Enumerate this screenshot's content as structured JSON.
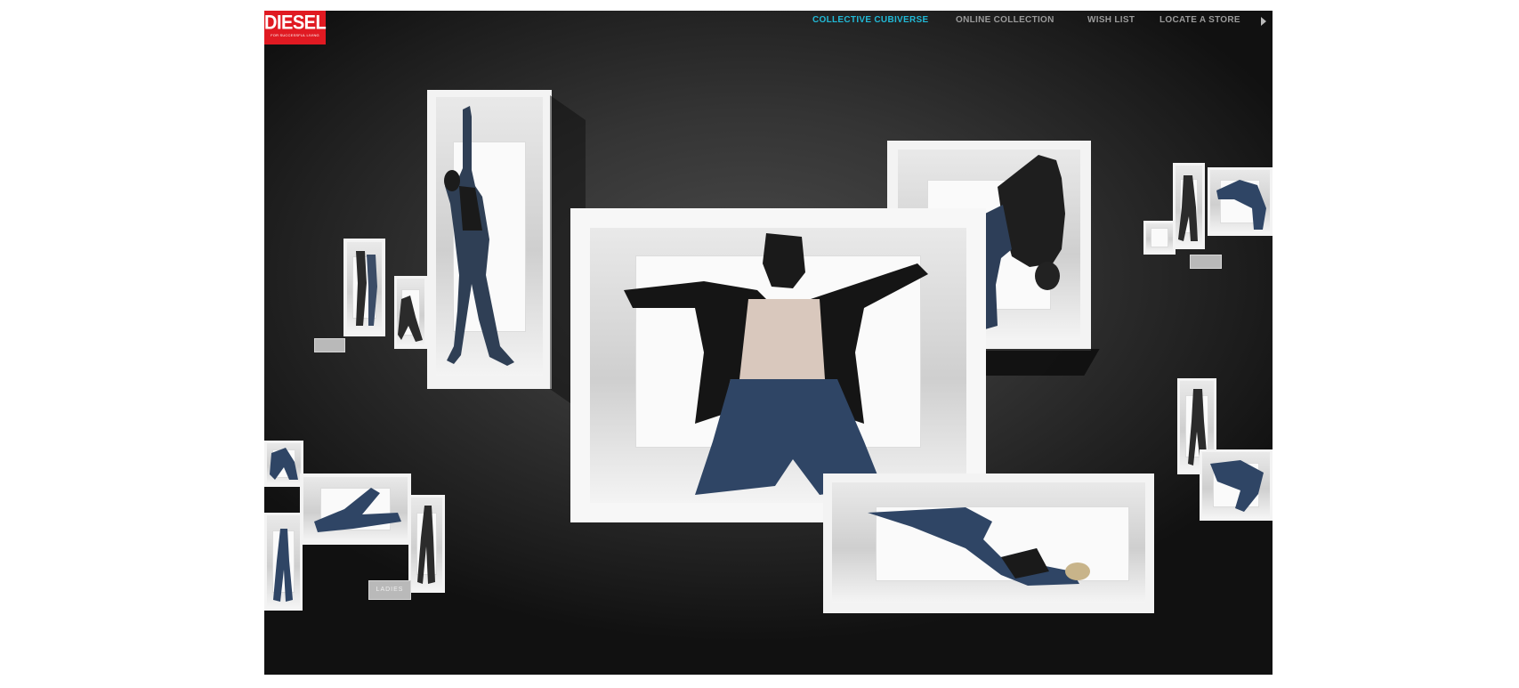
{
  "brand": {
    "name": "DIESEL",
    "tagline": "FOR SUCCESSFUL LIVING",
    "color": "#e01a22"
  },
  "nav": {
    "items": [
      {
        "label": "COLLECTIVE CUBIVERSE",
        "active": true
      },
      {
        "label": "ONLINE COLLECTION",
        "active": false
      },
      {
        "label": "WISH LIST",
        "active": false
      },
      {
        "label": "LOCATE A STORE",
        "active": false
      }
    ],
    "active_color": "#21b9d6",
    "inactive_color": "#9a9a9a",
    "more_icon": "play-triangle-icon"
  },
  "cube_labels": {
    "ladies": "LADIES"
  }
}
